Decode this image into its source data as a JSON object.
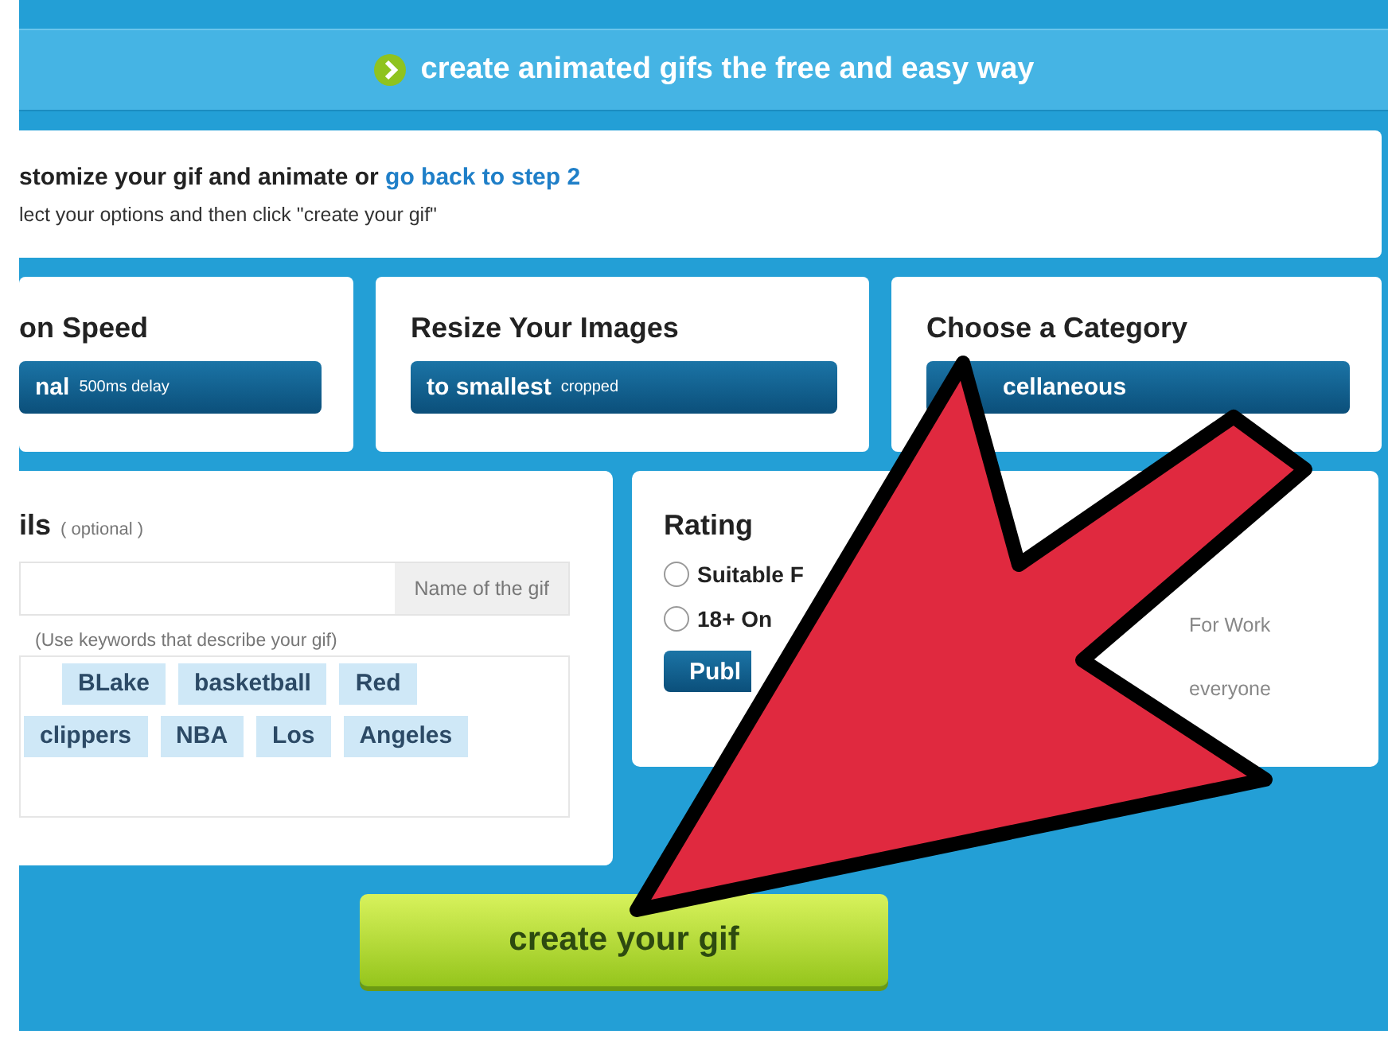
{
  "header": {
    "title": "create animated gifs the free and easy way"
  },
  "intro": {
    "heading": "stomize your gif and animate or ",
    "link": "go back to step 2",
    "hint": "lect your options and then click \"create your gif\""
  },
  "options": [
    {
      "title": "on Speed",
      "value": "nal",
      "note": "500ms delay"
    },
    {
      "title": "Resize Your Images",
      "value": "to smallest",
      "note": "cropped"
    },
    {
      "title": "Choose a Category",
      "value": "cellaneous"
    }
  ],
  "details": {
    "title": "ils",
    "optional": "( optional )",
    "name_addon": "Name of the gif",
    "tags_hint": "(Use keywords that describe your gif)",
    "tag_rows": [
      [
        "BLake",
        "basketball",
        "Red"
      ],
      [
        "clippers",
        "NBA",
        "Los",
        "Angeles"
      ]
    ]
  },
  "rating": {
    "title": "Rating",
    "options": [
      {
        "label": "Suitable F",
        "selected": false
      },
      {
        "label": "18+ On",
        "selected": false
      }
    ],
    "button": "Publ",
    "notes": [
      "For Work",
      "everyone"
    ]
  },
  "create_button": "create your gif"
}
